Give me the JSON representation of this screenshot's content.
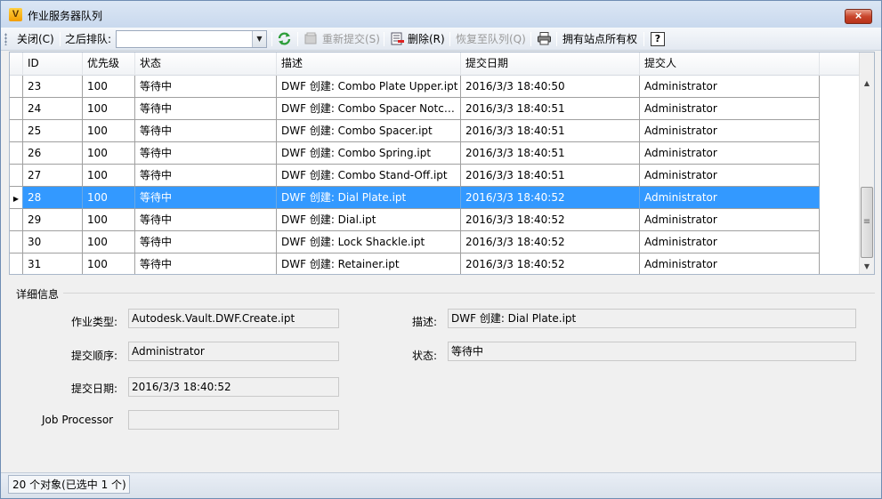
{
  "window": {
    "title": "作业服务器队列",
    "app_icon_letter": "V",
    "close_glyph": "×"
  },
  "toolbar": {
    "close_label": "关闭(C)",
    "requeue_label": "之后排队:",
    "requeue_value": "",
    "resubmit_label": "重新提交(S)",
    "delete_label": "删除(R)",
    "restore_label": "恢复至队列(Q)",
    "own_site_label": "拥有站点所有权",
    "help_glyph": "?"
  },
  "grid": {
    "columns": [
      "ID",
      "优先级",
      "状态",
      "描述",
      "提交日期",
      "提交人"
    ],
    "rows": [
      {
        "id": "23",
        "priority": "100",
        "status": "等待中",
        "desc": "DWF 创建: Combo Plate Upper.ipt",
        "date": "2016/3/3 18:40:50",
        "user": "Administrator"
      },
      {
        "id": "24",
        "priority": "100",
        "status": "等待中",
        "desc": "DWF 创建: Combo Spacer Notch....",
        "date": "2016/3/3 18:40:51",
        "user": "Administrator"
      },
      {
        "id": "25",
        "priority": "100",
        "status": "等待中",
        "desc": "DWF 创建: Combo Spacer.ipt",
        "date": "2016/3/3 18:40:51",
        "user": "Administrator"
      },
      {
        "id": "26",
        "priority": "100",
        "status": "等待中",
        "desc": "DWF 创建: Combo Spring.ipt",
        "date": "2016/3/3 18:40:51",
        "user": "Administrator"
      },
      {
        "id": "27",
        "priority": "100",
        "status": "等待中",
        "desc": "DWF 创建: Combo Stand-Off.ipt",
        "date": "2016/3/3 18:40:51",
        "user": "Administrator"
      },
      {
        "id": "28",
        "priority": "100",
        "status": "等待中",
        "desc": "DWF 创建: Dial Plate.ipt",
        "date": "2016/3/3 18:40:52",
        "user": "Administrator"
      },
      {
        "id": "29",
        "priority": "100",
        "status": "等待中",
        "desc": "DWF 创建: Dial.ipt",
        "date": "2016/3/3 18:40:52",
        "user": "Administrator"
      },
      {
        "id": "30",
        "priority": "100",
        "status": "等待中",
        "desc": "DWF 创建: Lock Shackle.ipt",
        "date": "2016/3/3 18:40:52",
        "user": "Administrator"
      },
      {
        "id": "31",
        "priority": "100",
        "status": "等待中",
        "desc": "DWF 创建: Retainer.ipt",
        "date": "2016/3/3 18:40:52",
        "user": "Administrator"
      }
    ],
    "selected_id": "28",
    "row_indicator_glyph": "▶",
    "scroll_up_glyph": "▲",
    "scroll_down_glyph": "▼",
    "scroll_grip_glyph": "≡"
  },
  "details": {
    "legend": "详细信息",
    "job_type_label": "作业类型:",
    "job_type_value": "Autodesk.Vault.DWF.Create.ipt",
    "submit_order_label": "提交顺序:",
    "submit_order_value": "Administrator",
    "submit_date_label": "提交日期:",
    "submit_date_value": "2016/3/3 18:40:52",
    "job_processor_label": "Job Processor",
    "job_processor_value": "",
    "desc_label": "描述:",
    "desc_value": "DWF 创建: Dial Plate.ipt",
    "status_label": "状态:",
    "status_value": "等待中"
  },
  "statusbar": {
    "text": "20 个对象(已选中 1 个)"
  },
  "colors": {
    "selection": "#3399ff",
    "titlebar": "#c9d9ee",
    "close": "#c9462c",
    "refresh": "#2e9e3a"
  }
}
